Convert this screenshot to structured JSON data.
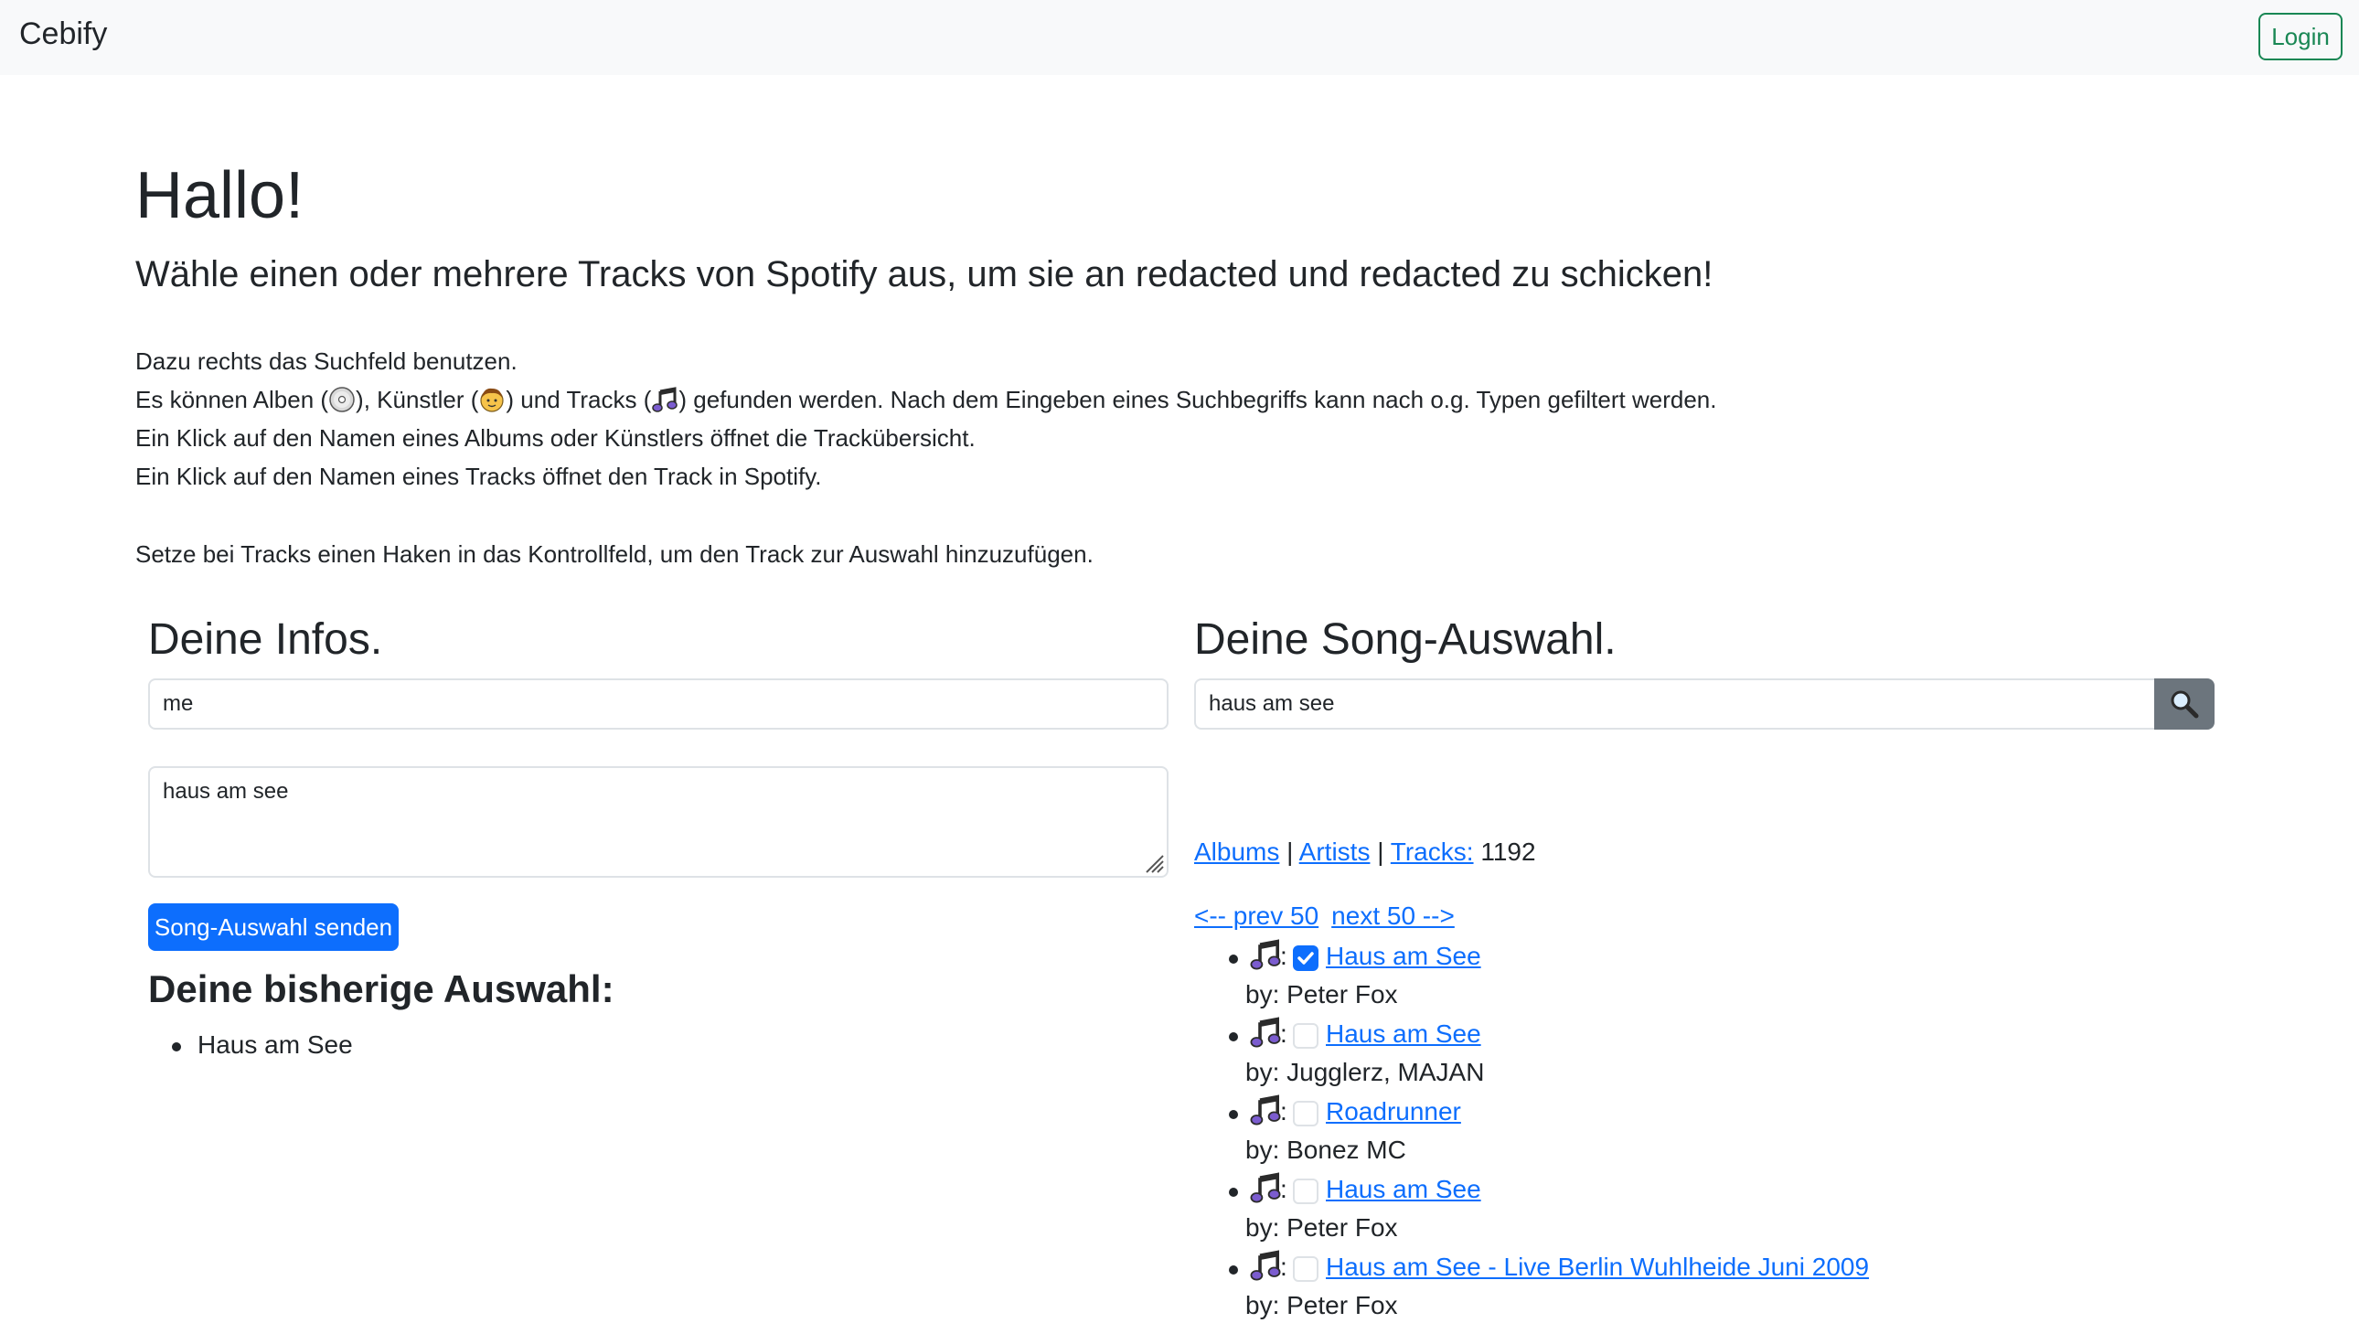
{
  "navbar": {
    "brand": "Cebify",
    "login_label": "Login"
  },
  "hero": {
    "title": "Hallo!",
    "lead": "Wähle einen oder mehrere Tracks von Spotify aus, um sie an redacted und redacted zu schicken!"
  },
  "intro": {
    "line1": "Dazu rechts das Suchfeld benutzen.",
    "line2_a": "Es können Alben (",
    "line2_b": "), Künstler (",
    "line2_c": ") und Tracks (",
    "line2_d": ") gefunden werden. Nach dem Eingeben eines Suchbegriffs kann nach o.g. Typen gefiltert werden.",
    "line3": "Ein Klick auf den Namen eines Albums oder Künstlers öffnet die Trackübersicht.",
    "line4": "Ein Klick auf den Namen eines Tracks öffnet den Track in Spotify.",
    "line5": "Setze bei Tracks einen Haken in das Kontrollfeld, um den Track zur Auswahl hinzuzufügen."
  },
  "icons": {
    "album": "album-disc-icon",
    "artist": "artist-face-icon",
    "track": "music-note-icon",
    "search": "search-icon"
  },
  "info": {
    "heading": "Deine Infos.",
    "name_value": "me",
    "message_value": "haus am see",
    "send_label": "Song-Auswahl senden",
    "selection_heading": "Deine bisherige Auswahl:",
    "selection": [
      "Haus am See"
    ]
  },
  "search": {
    "heading": "Deine Song-Auswahl.",
    "query": "haus am see",
    "filter_albums": "Albums",
    "filter_artists": "Artists",
    "filter_tracks": "Tracks:",
    "sep": "|",
    "track_count": "1192",
    "prev": "<-- prev 50",
    "next": "next 50 -->",
    "results": [
      {
        "title": "Haus am See",
        "by": "by: Peter Fox",
        "checked": true
      },
      {
        "title": "Haus am See",
        "by": "by: Jugglerz, MAJAN",
        "checked": false
      },
      {
        "title": "Roadrunner",
        "by": "by: Bonez MC",
        "checked": false
      },
      {
        "title": "Haus am See",
        "by": "by: Peter Fox",
        "checked": false
      },
      {
        "title": "Haus am See - Live Berlin Wuhlheide Juni 2009",
        "by": "by: Peter Fox",
        "checked": false
      }
    ],
    "result_colon": ":"
  },
  "colors": {
    "primary": "#0d6efd",
    "success": "#198754",
    "secondary": "#6c757d",
    "navbar_bg": "#f8f9fa",
    "text": "#212529"
  }
}
